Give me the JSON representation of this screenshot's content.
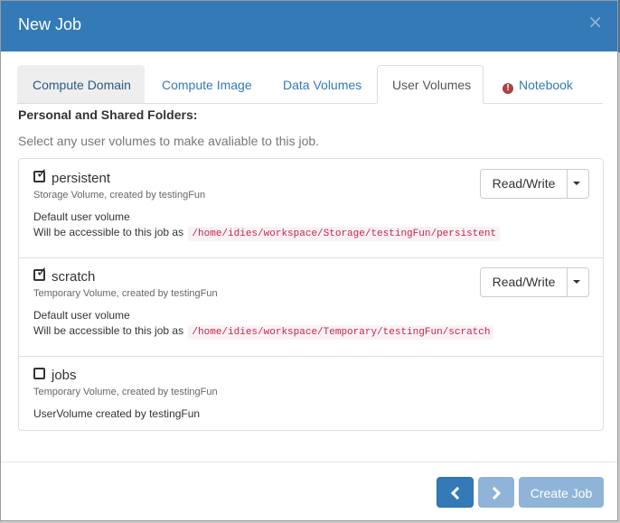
{
  "modal": {
    "title": "New Job",
    "close_glyph": "×"
  },
  "tabs": [
    {
      "label": "Compute Domain"
    },
    {
      "label": "Compute Image"
    },
    {
      "label": "Data Volumes"
    },
    {
      "label": "User Volumes"
    },
    {
      "label": "Notebook",
      "icon": "exclamation-circle-icon"
    }
  ],
  "section": {
    "title": "Personal and Shared Folders:",
    "help": "Select any user volumes to make avaliable to this job."
  },
  "volumes": [
    {
      "name": "persistent",
      "checked": true,
      "subtitle": "Storage Volume, created by testingFun",
      "description": "Default user volume",
      "access_prefix": "Will be accessible to this job as",
      "path": "/home/idies/workspace/Storage/testingFun/persistent",
      "mode": "Read/Write"
    },
    {
      "name": "scratch",
      "checked": true,
      "subtitle": "Temporary Volume, created by testingFun",
      "description": "Default user volume",
      "access_prefix": "Will be accessible to this job as",
      "path": "/home/idies/workspace/Temporary/testingFun/scratch",
      "mode": "Read/Write"
    },
    {
      "name": "jobs",
      "checked": false,
      "subtitle": "Temporary Volume, created by testingFun",
      "description": "UserVolume created by testingFun"
    }
  ],
  "footer": {
    "create_label": "Create Job"
  },
  "colors": {
    "header": "#337ab7",
    "primary": "#337ab7",
    "disabled": "#8fb4d8",
    "code_text": "#c7254e"
  }
}
